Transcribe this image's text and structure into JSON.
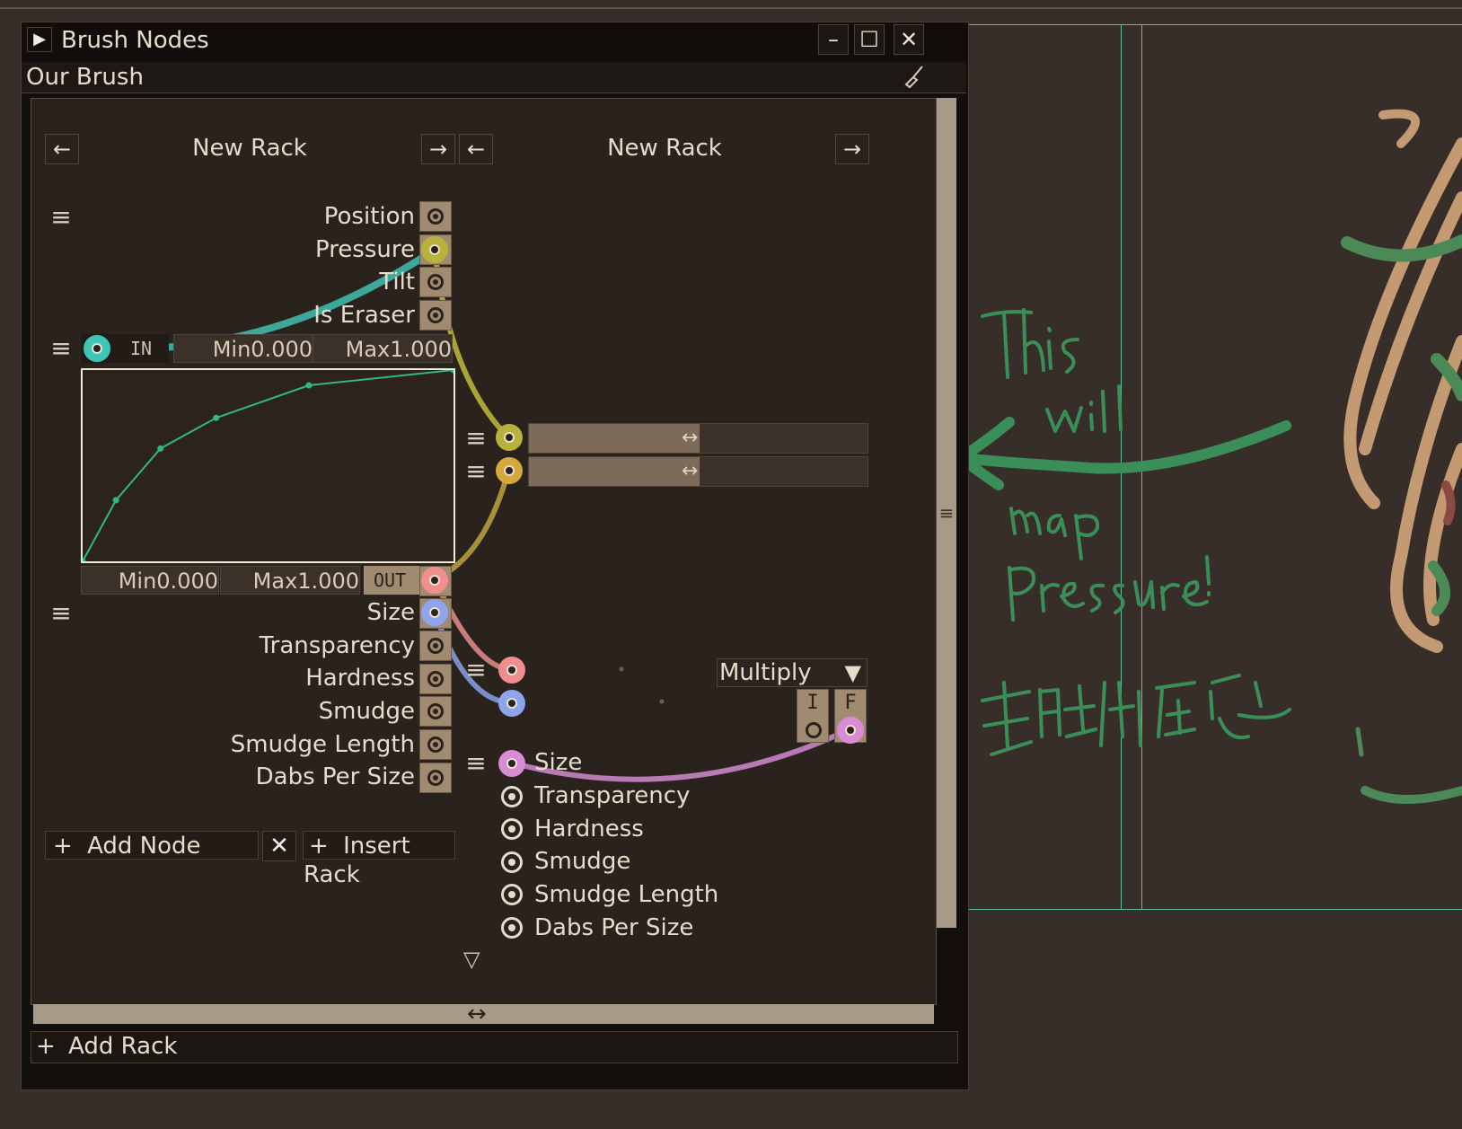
{
  "window": {
    "title": "Brush Nodes",
    "subtitle": "Our Brush"
  },
  "racks": [
    {
      "title": "New Rack",
      "prev_label": "←",
      "next_label": "→"
    },
    {
      "title": "New Rack",
      "prev_label": "←",
      "next_label": "→"
    }
  ],
  "input_ports": [
    "Position",
    "Pressure",
    "Tilt",
    "Is Eraser"
  ],
  "curve": {
    "in_label": "IN",
    "out_label": "OUT",
    "in_min": "Min0.000",
    "in_max": "Max1.000",
    "out_min": "Min0.000",
    "out_max": "Max1.000",
    "points": [
      [
        0,
        0
      ],
      [
        0.09,
        0.32
      ],
      [
        0.21,
        0.59
      ],
      [
        0.36,
        0.75
      ],
      [
        0.61,
        0.92
      ],
      [
        1,
        1
      ]
    ]
  },
  "output_ports": [
    "Size",
    "Transparency",
    "Hardness",
    "Smudge",
    "Smudge Length",
    "Dabs Per Size"
  ],
  "rack2_outputs": [
    "Size",
    "Transparency",
    "Hardness",
    "Smudge",
    "Smudge Length",
    "Dabs Per Size"
  ],
  "multiply": {
    "label": "Multiply",
    "i_label": "I",
    "f_label": "F"
  },
  "buttons": {
    "add_node": "Add Node",
    "insert_rack": "Insert Rack",
    "add_rack": "Add Rack",
    "plus": "+"
  },
  "colors": {
    "teal": "#3cc6b5",
    "olive": "#b7b33a",
    "gold": "#d6a73a",
    "pink": "#f08d8d",
    "blue": "#8ea4ec",
    "magenta": "#d98bd6",
    "curve": "#2fb784",
    "annotation": "#3a8f58"
  }
}
